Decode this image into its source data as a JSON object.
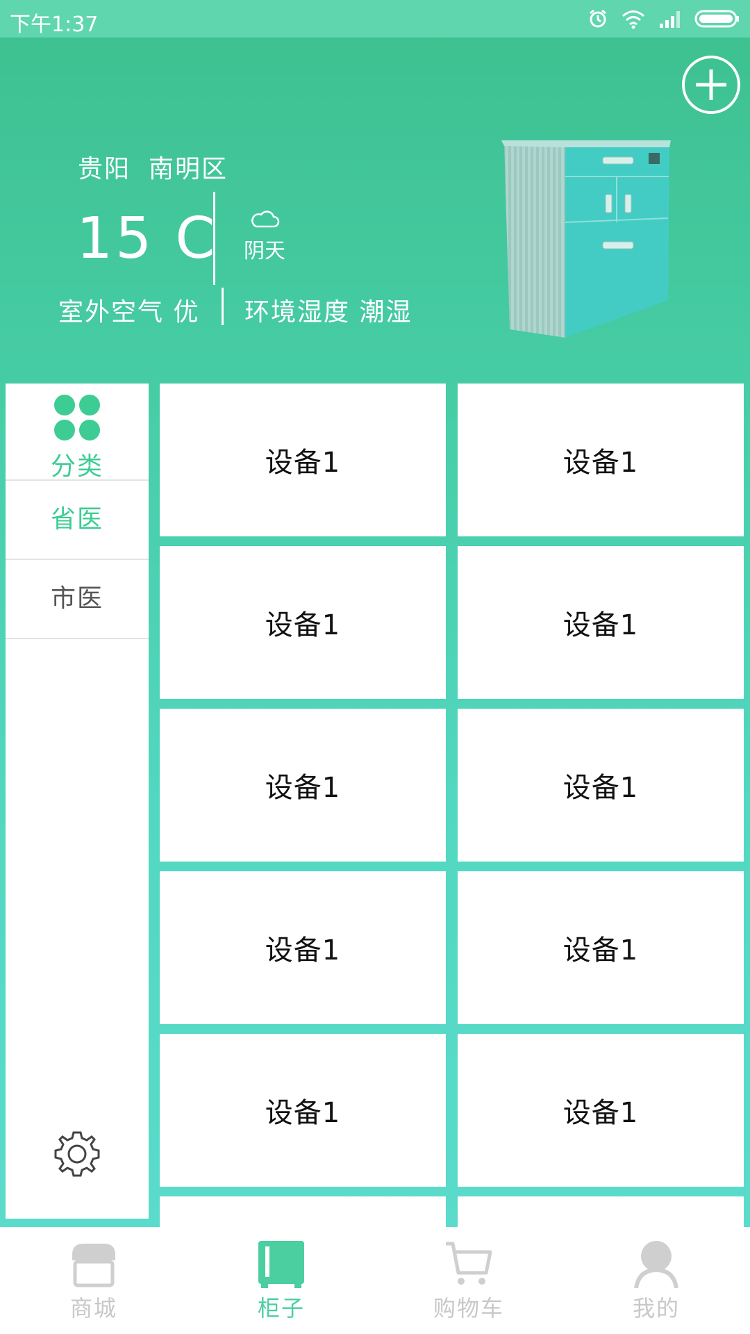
{
  "status_bar": {
    "time": "下午1:37"
  },
  "colors": {
    "accent": "#3dcc94",
    "header_gradient_top": "#3dc08f",
    "inactive_nav": "#c8c8c8"
  },
  "header": {
    "city": "贵阳",
    "district": "南明区",
    "temperature": "15 C",
    "weather": "阴天",
    "weather_icon": "cloud-icon",
    "air_quality": "室外空气 优",
    "humidity": "环境湿度 潮湿",
    "add_icon": "plus-circle-icon"
  },
  "sidebar": {
    "category_label": "分类",
    "items": [
      {
        "label": "省医",
        "active": true
      },
      {
        "label": "市医",
        "active": false
      }
    ],
    "settings_icon": "gear-icon"
  },
  "devices": [
    {
      "label": "设备1"
    },
    {
      "label": "设备1"
    },
    {
      "label": "设备1"
    },
    {
      "label": "设备1"
    },
    {
      "label": "设备1"
    },
    {
      "label": "设备1"
    },
    {
      "label": "设备1"
    },
    {
      "label": "设备1"
    },
    {
      "label": "设备1"
    },
    {
      "label": "设备1"
    }
  ],
  "bottom_nav": [
    {
      "label": "商城",
      "icon": "shop-icon",
      "active": false
    },
    {
      "label": "柜子",
      "icon": "cabinet-icon",
      "active": true
    },
    {
      "label": "购物车",
      "icon": "cart-icon",
      "active": false
    },
    {
      "label": "我的",
      "icon": "person-icon",
      "active": false
    }
  ]
}
